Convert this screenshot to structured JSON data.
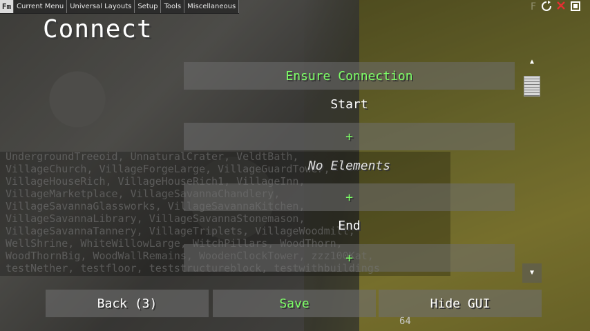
{
  "menu": {
    "logo": "Fm",
    "items": [
      "Current Menu",
      "Universal Layouts",
      "Setup",
      "Tools",
      "Miscellaneous"
    ]
  },
  "window": {
    "ghost_label": "F",
    "reload_icon": "reload-icon",
    "close_icon": "close-icon",
    "fullscreen_icon": "fullscreen-icon"
  },
  "page": {
    "title": "Connect"
  },
  "rows": {
    "ensure_connection": "Ensure Connection",
    "start": "Start",
    "add_1": "+",
    "no_elements": "No Elements",
    "add_2": "+",
    "end": "End",
    "add_3": "+"
  },
  "scrollbar": {
    "up_arrow": "▲",
    "down_arrow": "▼"
  },
  "buttons": {
    "back": "Back (3)",
    "save": "Save",
    "hide_gui": "Hide GUI"
  },
  "scene": {
    "text_lines": [
      "UndergroundTreeoid, UnnaturalCrater, VeldtBath,",
      "VillageChurch, VillageForgeLarge, VillageGuardTower,",
      "VillageHouseRich, VillageHouseRich1, VillageInn,",
      "VillageMarketplace, VillageSavannaChandlery,",
      "VillageSavannaGlassworks, VillageSavannaKitchen,",
      "VillageSavannaLibrary, VillageSavannaStonemason,",
      "VillageSavannaTannery, VillageTriplets, VillageWoodmill,",
      "WellShrine, WhiteWillowLarge, WitchPillars, WoodThorn,",
      "WoodThornBig, WoodWallRemains, WoodenClockTower, zzz100Kat,",
      "testNether, testfloor, teststructureblock, testwithbuildings"
    ],
    "hotbar_count": "64"
  },
  "colors": {
    "accent_green": "#7cff66",
    "close_red": "#e03030"
  }
}
